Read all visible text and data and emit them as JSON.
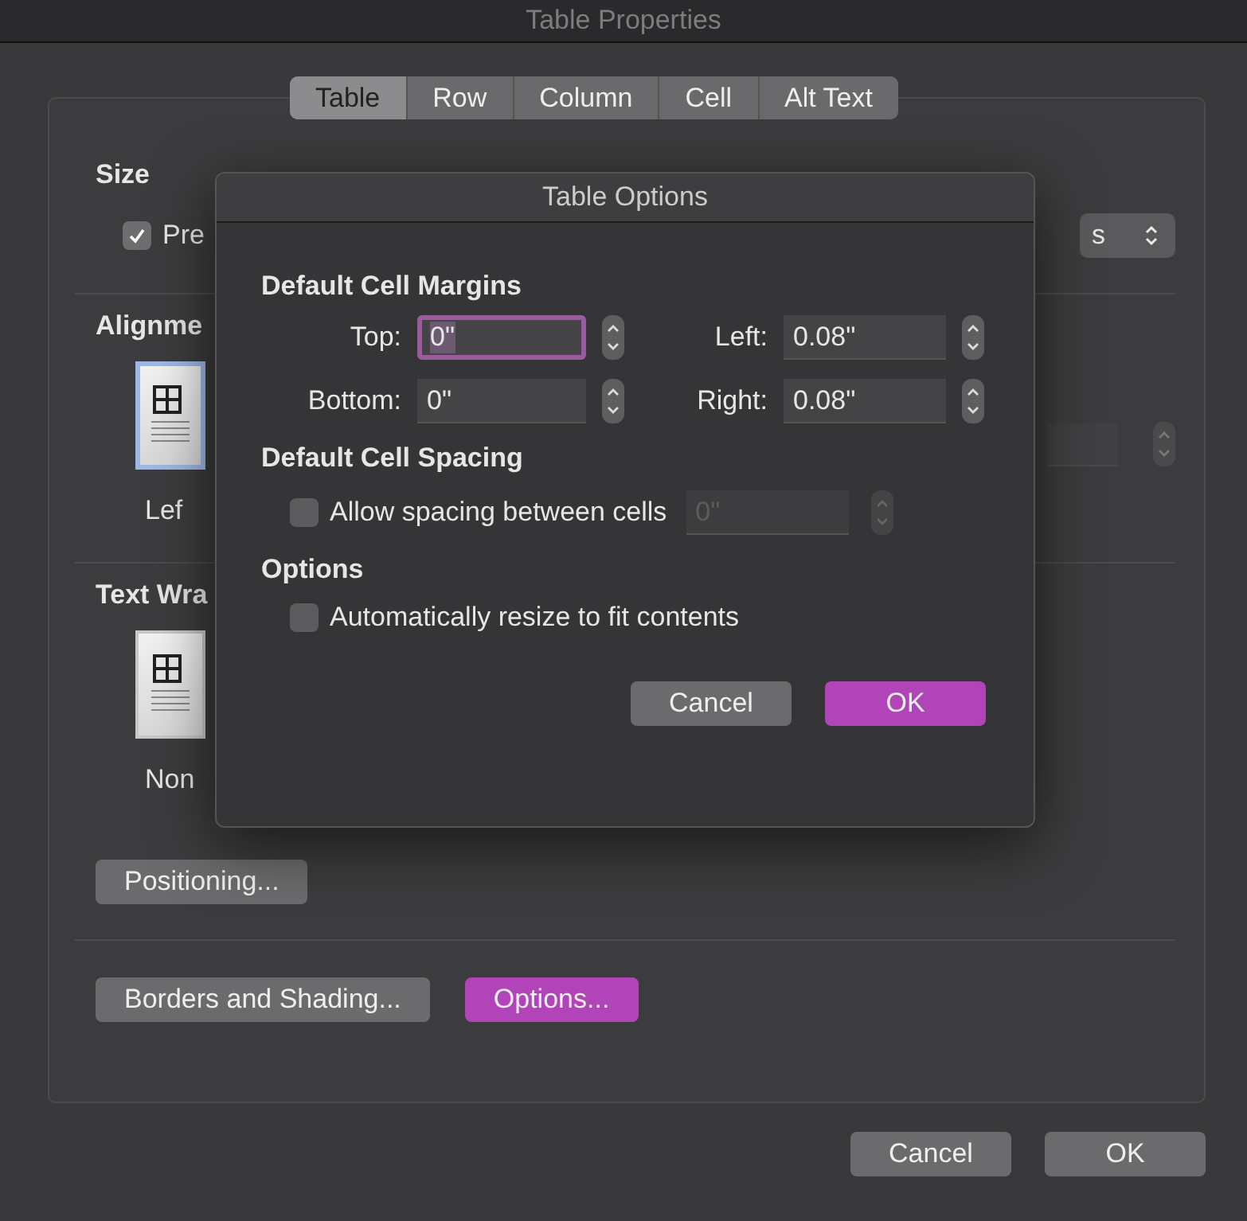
{
  "window": {
    "title": "Table Properties"
  },
  "tabs": [
    {
      "label": "Table",
      "selected": true
    },
    {
      "label": "Row",
      "selected": false
    },
    {
      "label": "Column",
      "selected": false
    },
    {
      "label": "Cell",
      "selected": false
    },
    {
      "label": "Alt Text",
      "selected": false
    }
  ],
  "size": {
    "heading": "Size",
    "preferred_width": {
      "label": "Pre",
      "checked": true
    },
    "unit_popup": "s"
  },
  "alignment": {
    "heading": "Alignme",
    "option": {
      "label": "Lef",
      "selected": true
    }
  },
  "text_wrapping": {
    "heading": "Text Wra",
    "option": {
      "label": "Non",
      "selected": false
    }
  },
  "buttons": {
    "positioning": "Positioning...",
    "borders": "Borders and Shading...",
    "options": "Options..."
  },
  "footer": {
    "cancel": "Cancel",
    "ok": "OK"
  },
  "sheet": {
    "title": "Table Options",
    "margins": {
      "heading": "Default Cell Margins",
      "fields": [
        {
          "label": "Top:",
          "value": "0\"",
          "focused": true
        },
        {
          "label": "Left:",
          "value": "0.08\"",
          "focused": false
        },
        {
          "label": "Bottom:",
          "value": "0\"",
          "focused": false
        },
        {
          "label": "Right:",
          "value": "0.08\"",
          "focused": false
        }
      ]
    },
    "spacing": {
      "heading": "Default Cell Spacing",
      "checkbox": {
        "label": "Allow spacing between cells",
        "checked": false
      },
      "value": "0\"",
      "disabled": true
    },
    "options": {
      "heading": "Options",
      "checkbox": {
        "label": "Automatically resize to fit contents",
        "checked": false
      }
    },
    "cancel": "Cancel",
    "ok": "OK"
  }
}
